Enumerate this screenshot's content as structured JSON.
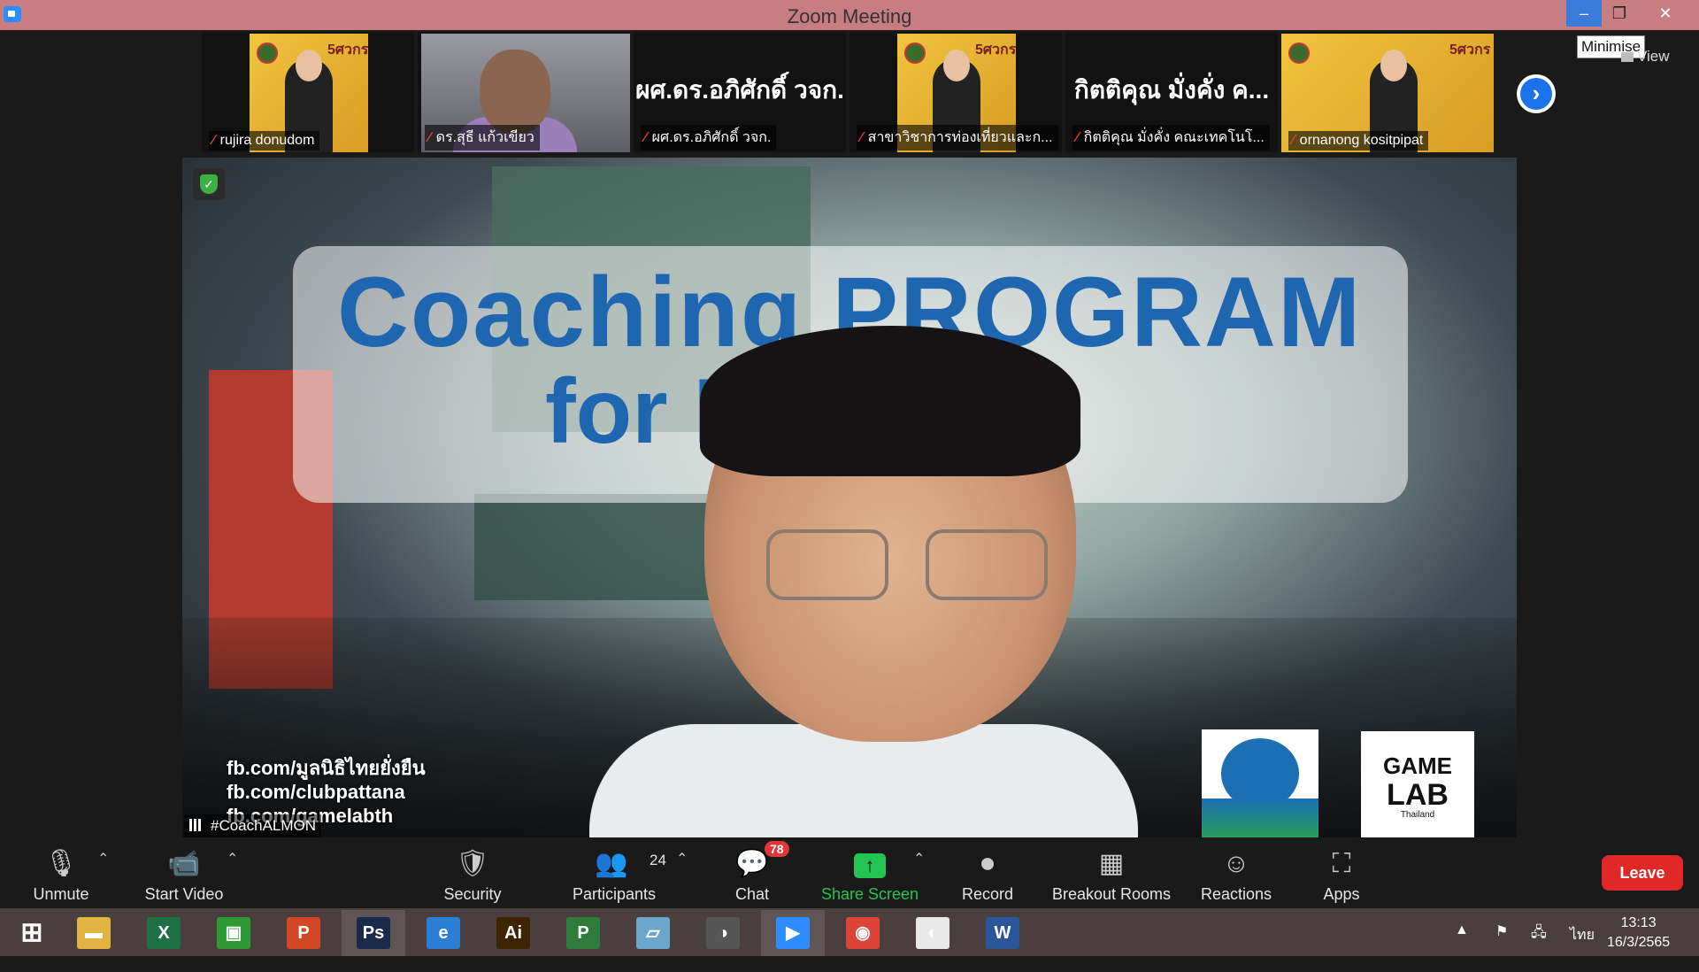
{
  "window": {
    "title": "Zoom Meeting",
    "tooltip": "Minimise",
    "view_label": "View",
    "min_glyph": "–",
    "max_glyph": "❐",
    "close_glyph": "✕"
  },
  "participants_strip": [
    {
      "name": "rujira donudom",
      "type": "poster",
      "badge": "5ศวกร"
    },
    {
      "name": "ดร.สุธี แก้วเขียว",
      "type": "photo"
    },
    {
      "name": "ผศ.ดร.อภิศักดิ์ วจก.",
      "type": "text",
      "big_name": "ผศ.ดร.อภิศักดิ์ วจก."
    },
    {
      "name": "สาขาวิชาการท่องเที่ยวและก...",
      "type": "poster",
      "badge": "5ศวกร"
    },
    {
      "name": "กิตติคุณ มั่งคั่ง คณะเทคโนโ...",
      "type": "text",
      "big_name": "กิตติคุณ มั่งคั่ง ค..."
    },
    {
      "name": "ornanong kositpipat",
      "type": "poster",
      "badge": "5ศวกร"
    }
  ],
  "main_video": {
    "headline_line1": "Coaching PROGRAM",
    "headline_line2": "for L        er",
    "links": [
      "fb.com/มูลนิธิไทยยั่งยืน",
      "fb.com/clubpattana",
      "fb.com/gamelabth"
    ],
    "logo2_line1": "GAME",
    "logo2_line2": "LAB",
    "logo2_line3": "Thailand",
    "speaker_label": "#CoachALMON"
  },
  "toolbar": {
    "unmute": "Unmute",
    "start_video": "Start Video",
    "security": "Security",
    "participants": "Participants",
    "participants_count": "24",
    "chat": "Chat",
    "chat_badge": "78",
    "share_screen": "Share Screen",
    "record": "Record",
    "breakout_rooms": "Breakout Rooms",
    "reactions": "Reactions",
    "apps": "Apps",
    "leave": "Leave"
  },
  "taskbar": {
    "apps": [
      {
        "icon": "explorer-icon",
        "glyph": "▬",
        "color": "#e3b341"
      },
      {
        "icon": "excel-icon",
        "glyph": "X",
        "color": "#1e7145"
      },
      {
        "icon": "store-icon",
        "glyph": "▣",
        "color": "#2f9a35"
      },
      {
        "icon": "powerpoint-icon",
        "glyph": "P",
        "color": "#d24726"
      },
      {
        "icon": "photoshop-icon",
        "glyph": "Ps",
        "color": "#1b2a4a"
      },
      {
        "icon": "internet-explorer-icon",
        "glyph": "e",
        "color": "#2a7fd4"
      },
      {
        "icon": "illustrator-icon",
        "glyph": "Ai",
        "color": "#3d2300"
      },
      {
        "icon": "project-icon",
        "glyph": "P",
        "color": "#2e7b3a"
      },
      {
        "icon": "notepad-icon",
        "glyph": "▱",
        "color": "#6aa7c8"
      },
      {
        "icon": "photoscape-icon",
        "glyph": "◑",
        "color": "#555555"
      },
      {
        "icon": "zoom-icon",
        "glyph": "▶",
        "color": "#2d8cff"
      },
      {
        "icon": "chrome-icon",
        "glyph": "◉",
        "color": "#db4437"
      },
      {
        "icon": "paint-icon",
        "glyph": "◐",
        "color": "#e9e9e9"
      },
      {
        "icon": "word-icon",
        "glyph": "W",
        "color": "#2b579a"
      }
    ],
    "language": "ไทย",
    "time": "13:13",
    "date": "16/3/2565"
  }
}
